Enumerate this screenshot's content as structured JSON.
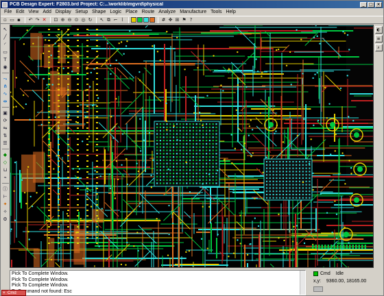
{
  "window": {
    "title": "PCB Design Expert: F2803.brd  Project: C:...\\worklib\\mgvrd\\physical"
  },
  "menus": [
    "File",
    "Edit",
    "View",
    "Add",
    "Display",
    "Setup",
    "Shape",
    "Logic",
    "Place",
    "Route",
    "Analyze",
    "Manufacture",
    "Tools",
    "Help"
  ],
  "console": {
    "lines": [
      "Pick To Complete Window.",
      "Pick To Complete Window.",
      "Pick To Complete Window.",
      "E- Command not found: Esc"
    ],
    "tab_label": "Cmd"
  },
  "status": {
    "command": "Cmd",
    "state": "Idle",
    "coord_label": "x,y:",
    "coords": "9360.00, 18165.00"
  },
  "icons": {
    "toolbar": [
      "new-icon",
      "open-icon",
      "save-icon",
      "undo-icon",
      "redo-icon",
      "delete-icon",
      "zoom-fit-icon",
      "zoom-in-icon",
      "zoom-out-icon",
      "zoom-previous-icon",
      "zoom-world-icon",
      "redraw-icon",
      "move-icon",
      "copy-icon",
      "add-connect-icon",
      "slide-icon",
      "color-icon",
      "layer-visibility-icon"
    ]
  },
  "colors": {
    "trace_green": "#00c840",
    "trace_cyan": "#30e0e0",
    "trace_orange": "#e07020",
    "trace_yellow": "#e8d000",
    "trace_red": "#c02020",
    "title_bar": "#0a246a"
  }
}
